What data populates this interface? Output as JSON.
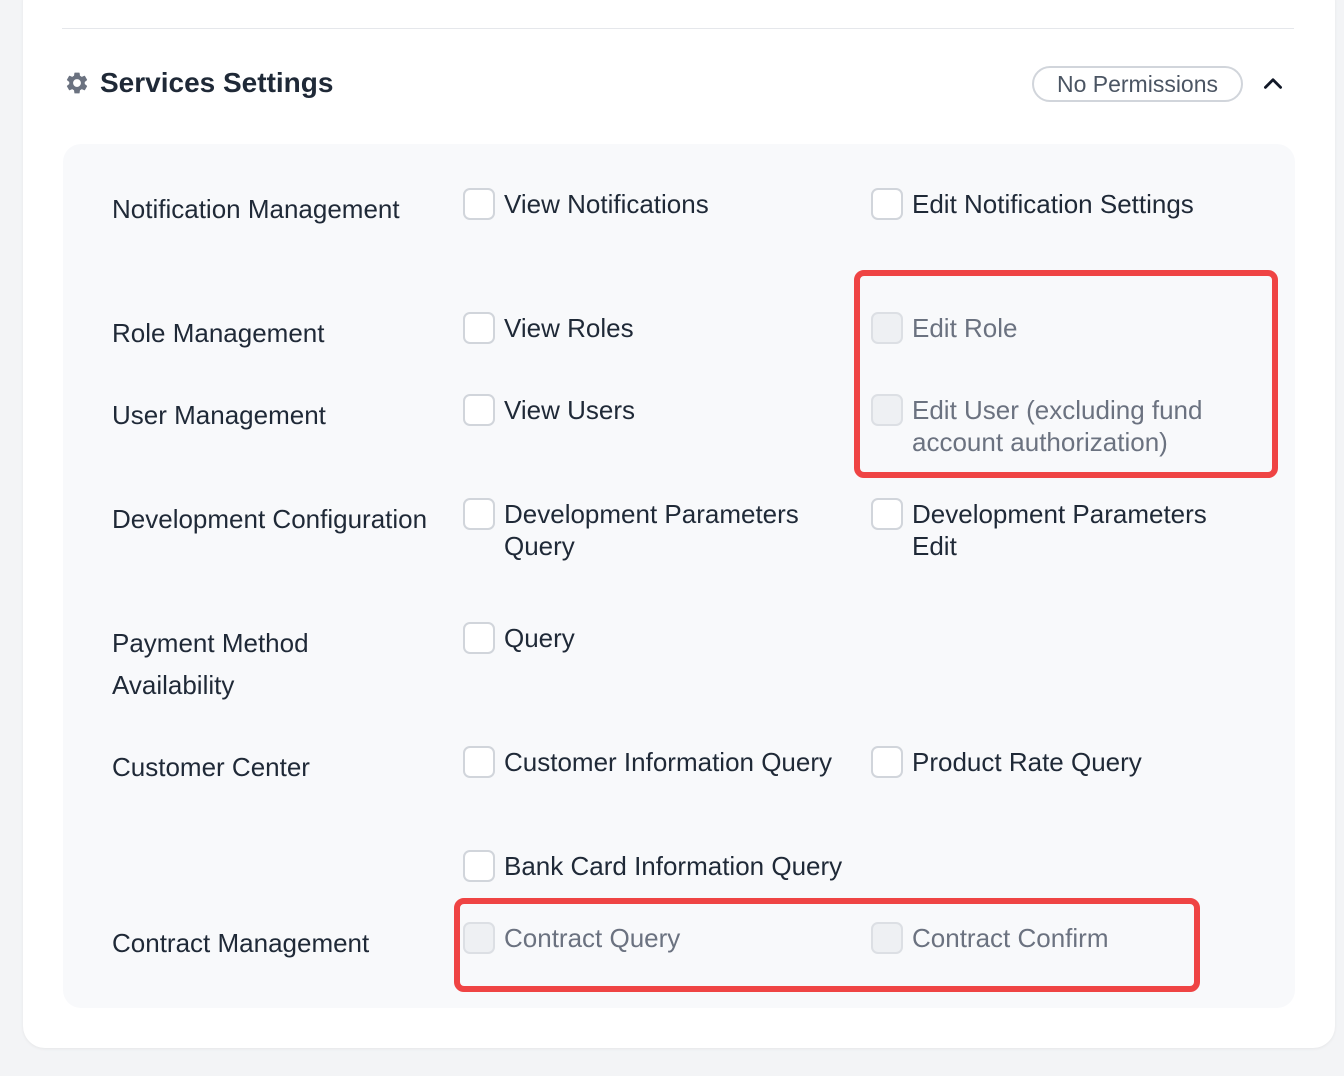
{
  "section": {
    "title": "Services Settings",
    "title_icon": "gear-icon",
    "badge": "No Permissions",
    "toggle_icon": "chevron-up-icon"
  },
  "rows": [
    {
      "label": "Notification Management",
      "options": [
        {
          "label": "View Notifications",
          "checked": false,
          "disabled": false
        },
        {
          "label": "Edit Notification Settings",
          "checked": false,
          "disabled": false
        }
      ]
    },
    {
      "label": "Role Management",
      "options": [
        {
          "label": "View Roles",
          "checked": false,
          "disabled": false
        },
        {
          "label": "Edit Role",
          "checked": false,
          "disabled": true
        }
      ]
    },
    {
      "label": "User Management",
      "options": [
        {
          "label": "View Users",
          "checked": false,
          "disabled": false
        },
        {
          "label": "Edit User (excluding fund account authorization)",
          "checked": false,
          "disabled": true
        }
      ]
    },
    {
      "label": "Development Configuration",
      "options": [
        {
          "label": "Development Parameters Query",
          "checked": false,
          "disabled": false
        },
        {
          "label": "Development Parameters Edit",
          "checked": false,
          "disabled": false
        }
      ]
    },
    {
      "label": "Payment Method Availability",
      "options": [
        {
          "label": "Query",
          "checked": false,
          "disabled": false
        }
      ]
    },
    {
      "label": "Customer Center",
      "options": [
        {
          "label": "Customer Information Query",
          "checked": false,
          "disabled": false
        },
        {
          "label": "Product Rate Query",
          "checked": false,
          "disabled": false
        },
        {
          "label": "Bank Card Information Query",
          "checked": false,
          "disabled": false
        }
      ]
    },
    {
      "label": "Contract Management",
      "options": [
        {
          "label": "Contract Query",
          "checked": false,
          "disabled": true
        },
        {
          "label": "Contract Confirm",
          "checked": false,
          "disabled": true
        }
      ]
    }
  ],
  "colors": {
    "highlight": "#ef4444",
    "panel_bg": "#f8f9fb",
    "disabled_text": "#6b7280"
  }
}
